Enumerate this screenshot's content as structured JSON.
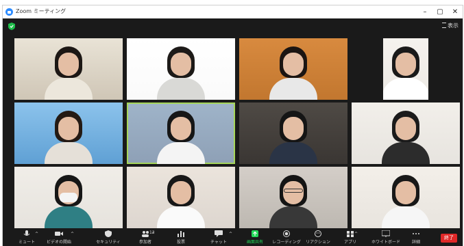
{
  "window": {
    "title": "Zoom ミーティング",
    "controls": {
      "minimize": "–",
      "maximize": "▢",
      "close": "✕"
    }
  },
  "topbar": {
    "view_label": "表示"
  },
  "participants": [
    {
      "id": "p1",
      "bg": "#cfc6b6",
      "top": "#e9e3d6",
      "shirt": "#ece7dc",
      "hair": "#1c1714"
    },
    {
      "id": "p2",
      "bg": "#fafafa",
      "top": "#ffffff",
      "shirt": "#d9d9d6",
      "hair": "#1d1a18"
    },
    {
      "id": "p3",
      "bg": "#c2772f",
      "top": "#d88a3f",
      "shirt": "#e8e8e8",
      "hair": "#1b1512"
    },
    {
      "id": "p4",
      "bg": "#ece9e4",
      "top": "#f5f2ee",
      "shirt": "#ffffff",
      "hair": "#1a1a1a"
    },
    {
      "id": "p5",
      "bg": "#5fa0d4",
      "top": "#8cc3ec",
      "shirt": "#e5e0d8",
      "hair": "#241a14"
    },
    {
      "id": "p6",
      "bg": "#8ea0b6",
      "top": "#9fb4c9",
      "shirt": "#f4f4f4",
      "hair": "#161616",
      "active": true
    },
    {
      "id": "p7",
      "bg": "#3a3633",
      "top": "#4f4a45",
      "shirt": "#2a3446",
      "hair": "#151515"
    },
    {
      "id": "p8",
      "bg": "#e7e4df",
      "top": "#f2efea",
      "shirt": "#2c2c2c",
      "hair": "#1b1b1b"
    },
    {
      "id": "p9",
      "bg": "#e6e3dd",
      "top": "#f0ede8",
      "shirt": "#2f7f84",
      "hair": "#161616",
      "mask": true
    },
    {
      "id": "p10",
      "bg": "#ddd6cf",
      "top": "#ebe4dc",
      "shirt": "#fafafa",
      "hair": "#181818"
    },
    {
      "id": "p11",
      "bg": "#bdb8b1",
      "top": "#d4cec8",
      "shirt": "#383838",
      "hair": "#141414",
      "glasses": true
    },
    {
      "id": "p12",
      "bg": "#e8e4de",
      "top": "#f3efe9",
      "shirt": "#f6f6f6",
      "hair": "#181818"
    }
  ],
  "toolbar": {
    "items": [
      {
        "name": "mute-button",
        "icon": "mic-icon",
        "label": "ミュート"
      },
      {
        "name": "stop-video-button",
        "icon": "video-icon",
        "label": "ビデオの開始"
      },
      {
        "name": "security-button",
        "icon": "shield-icon",
        "label": "セキュリティ"
      },
      {
        "name": "participants-button",
        "icon": "people-icon",
        "label": "参加者",
        "count": "12"
      },
      {
        "name": "polls-button",
        "icon": "poll-icon",
        "label": "投票"
      },
      {
        "name": "chat-button",
        "icon": "chat-icon",
        "label": "チャット"
      },
      {
        "name": "share-screen-button",
        "icon": "share-icon",
        "label": "画面共有"
      },
      {
        "name": "record-button",
        "icon": "record-icon",
        "label": "レコーディング"
      },
      {
        "name": "reactions-button",
        "icon": "emoji-icon",
        "label": "リアクション"
      },
      {
        "name": "apps-button",
        "icon": "apps-icon",
        "label": "アプリ"
      },
      {
        "name": "whiteboard-button",
        "icon": "whiteboard-icon",
        "label": "ホワイトボード"
      },
      {
        "name": "more-button",
        "icon": "more-icon",
        "label": "詳細"
      }
    ],
    "end_label": "終了",
    "colors": {
      "share": "#23d959",
      "end": "#e02828"
    }
  }
}
